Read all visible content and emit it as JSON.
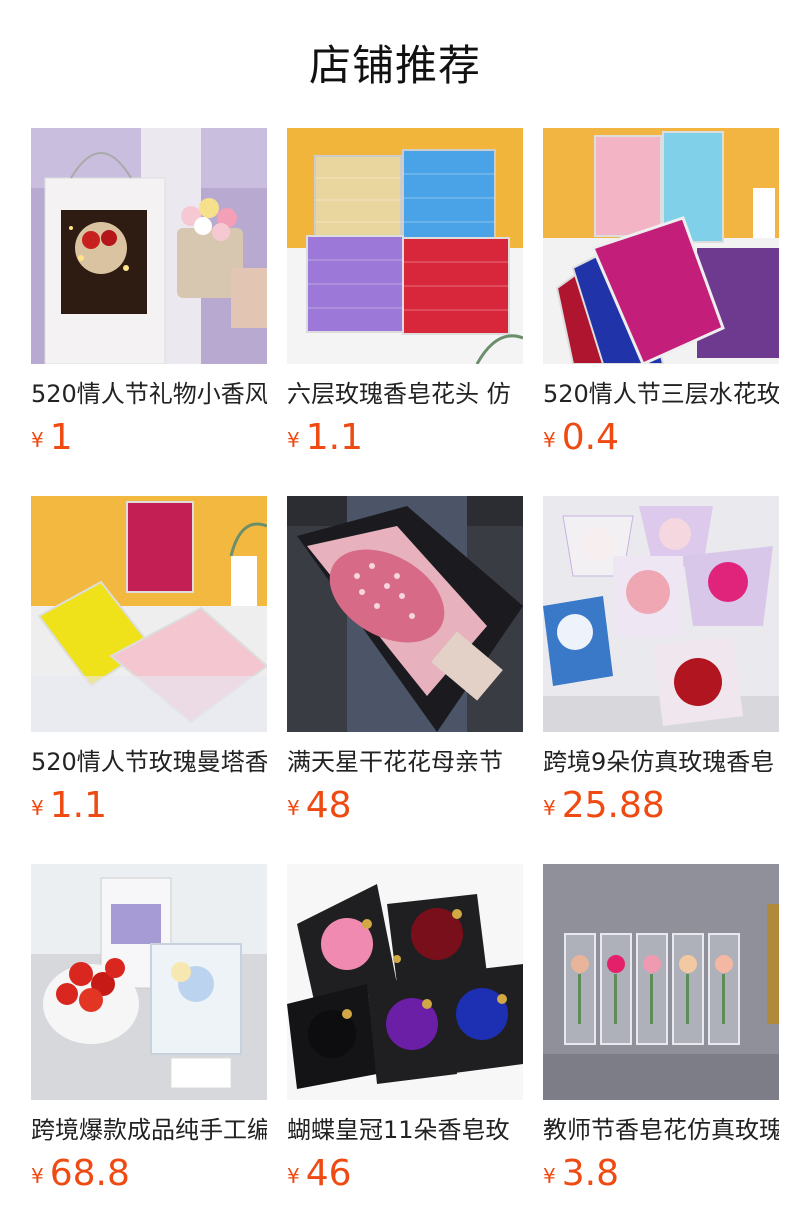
{
  "header": {
    "title": "店铺推荐"
  },
  "currency_symbol": "¥",
  "products": [
    {
      "name": "520情人节礼物小香风",
      "price": "1",
      "image": "bouquet-in-gift-bag-icon"
    },
    {
      "name": "六层玫瑰香皂花头 仿",
      "price": "1.1",
      "image": "soap-rose-boxes-icon"
    },
    {
      "name": "520情人节三层水花玫",
      "price": "0.4",
      "image": "layered-soap-rose-boxes-icon"
    },
    {
      "name": "520情人节玫瑰曼塔香",
      "price": "1.1",
      "image": "yellow-pink-rose-boxes-icon"
    },
    {
      "name": "满天星干花花母亲节",
      "price": "48",
      "image": "babys-breath-bouquet-icon"
    },
    {
      "name": "跨境9朵仿真玫瑰香皂",
      "price": "25.88",
      "image": "mini-rose-bouquets-icon"
    },
    {
      "name": "跨境爆款成品纯手工编",
      "price": "68.8",
      "image": "crochet-bouquet-box-icon"
    },
    {
      "name": "蝴蝶皇冠11朵香皂玫",
      "price": "46",
      "image": "butterfly-crown-bouquets-icon"
    },
    {
      "name": "教师节香皂花仿真玫瑰",
      "price": "3.8",
      "image": "boxed-single-roses-icon"
    }
  ]
}
